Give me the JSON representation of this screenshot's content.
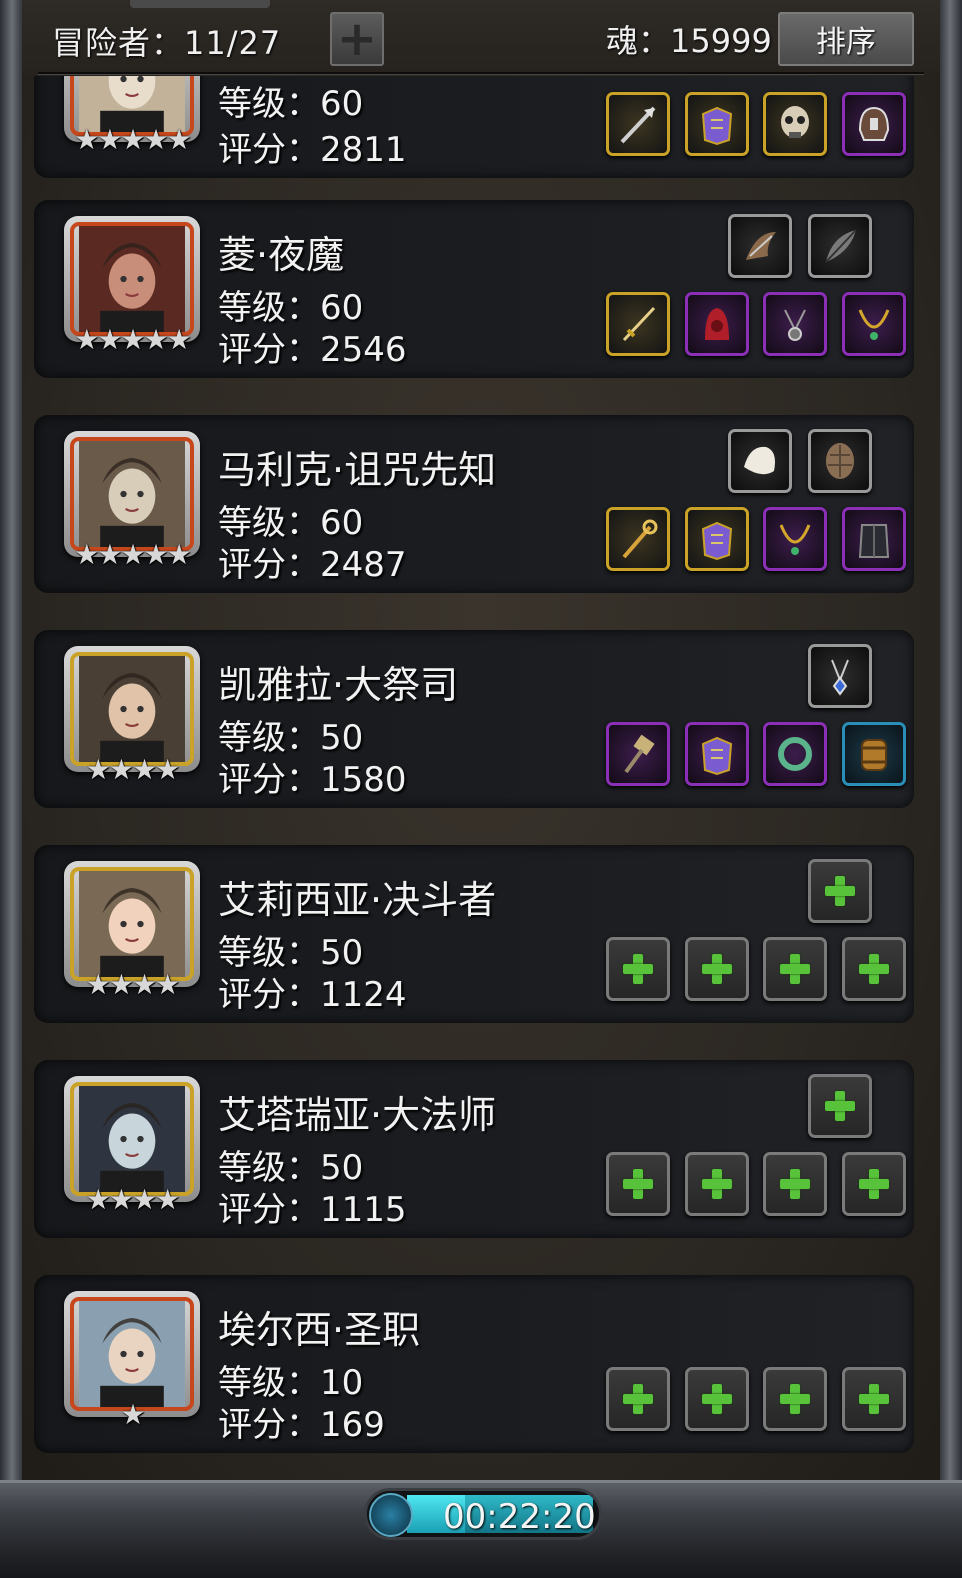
{
  "header": {
    "adventurers_label": "冒险者：11/27",
    "add_symbol": "+",
    "soul_label": "魂：15999",
    "sort_label": "排序"
  },
  "heroes": [
    {
      "name": "等级：60",
      "level": "",
      "score": "评分：2811",
      "stars": "★★★★★",
      "frame": "red",
      "gear_top": [],
      "gear_bottom": [
        {
          "icon": "spear-icon",
          "rarity": "gold"
        },
        {
          "icon": "armor-icon",
          "rarity": "gold"
        },
        {
          "icon": "skull-mask-icon",
          "rarity": "gold"
        },
        {
          "icon": "helmet-icon",
          "rarity": "purple"
        }
      ]
    },
    {
      "name": "菱·夜魔",
      "level": "等级：60",
      "score": "评分：2546",
      "stars": "★★★★★",
      "frame": "red",
      "gear_top": [
        {
          "icon": "claw-icon",
          "rarity": "grey"
        },
        {
          "icon": "feather-icon",
          "rarity": "grey"
        }
      ],
      "gear_bottom": [
        {
          "icon": "dagger-icon",
          "rarity": "gold"
        },
        {
          "icon": "hood-icon",
          "rarity": "purple"
        },
        {
          "icon": "amulet-icon",
          "rarity": "purple"
        },
        {
          "icon": "necklace-icon",
          "rarity": "purple"
        }
      ]
    },
    {
      "name": "马利克·诅咒先知",
      "level": "等级：60",
      "score": "评分：2487",
      "stars": "★★★★★",
      "frame": "red",
      "gear_top": [
        {
          "icon": "fur-icon",
          "rarity": "grey"
        },
        {
          "icon": "shell-icon",
          "rarity": "grey"
        }
      ],
      "gear_bottom": [
        {
          "icon": "staff-icon",
          "rarity": "gold"
        },
        {
          "icon": "armor-icon",
          "rarity": "gold"
        },
        {
          "icon": "necklace-icon",
          "rarity": "purple"
        },
        {
          "icon": "cloak-icon",
          "rarity": "purple"
        }
      ]
    },
    {
      "name": "凯雅拉·大祭司",
      "level": "等级：50",
      "score": "评分：1580",
      "stars": "★★★★",
      "frame": "gold",
      "gear_top": [
        {
          "icon": "pendant-icon",
          "rarity": "grey"
        }
      ],
      "gear_bottom": [
        {
          "icon": "hammer-icon",
          "rarity": "purple"
        },
        {
          "icon": "armor-icon",
          "rarity": "purple"
        },
        {
          "icon": "ring-icon",
          "rarity": "purple"
        },
        {
          "icon": "barrel-icon",
          "rarity": "blue"
        }
      ]
    },
    {
      "name": "艾莉西亚·决斗者",
      "level": "等级：50",
      "score": "评分：1124",
      "stars": "★★★★",
      "frame": "gold",
      "gear_top": [
        {
          "icon": "add-relic-icon",
          "rarity": "empty"
        }
      ],
      "gear_bottom": [
        {
          "icon": "add-weapon-icon",
          "rarity": "empty"
        },
        {
          "icon": "add-armor-icon",
          "rarity": "empty"
        },
        {
          "icon": "add-accessory-icon",
          "rarity": "empty"
        },
        {
          "icon": "add-accessory-icon",
          "rarity": "empty"
        }
      ]
    },
    {
      "name": "艾塔瑞亚·大法师",
      "level": "等级：50",
      "score": "评分：1115",
      "stars": "★★★★",
      "frame": "gold",
      "gear_top": [
        {
          "icon": "add-relic-icon",
          "rarity": "empty"
        }
      ],
      "gear_bottom": [
        {
          "icon": "add-weapon-icon",
          "rarity": "empty"
        },
        {
          "icon": "add-armor-icon",
          "rarity": "empty"
        },
        {
          "icon": "add-accessory-icon",
          "rarity": "empty"
        },
        {
          "icon": "add-accessory-icon",
          "rarity": "empty"
        }
      ]
    },
    {
      "name": "埃尔西·圣职",
      "level": "等级：10",
      "score": "评分：169",
      "stars": "★",
      "frame": "red",
      "gear_top": [],
      "gear_bottom": [
        {
          "icon": "add-weapon-icon",
          "rarity": "empty"
        },
        {
          "icon": "add-armor-icon",
          "rarity": "empty"
        },
        {
          "icon": "add-accessory-icon",
          "rarity": "empty"
        },
        {
          "icon": "add-accessory-icon",
          "rarity": "empty"
        }
      ]
    }
  ],
  "footer": {
    "timer": "00:22:20",
    "timer_progress": 0.25
  },
  "colors": {
    "gold": "#c9a227",
    "purple": "#8a2fb6",
    "blue": "#2a8fb6",
    "red_frame": "#c6471c",
    "plus_green": "#58c23a"
  }
}
